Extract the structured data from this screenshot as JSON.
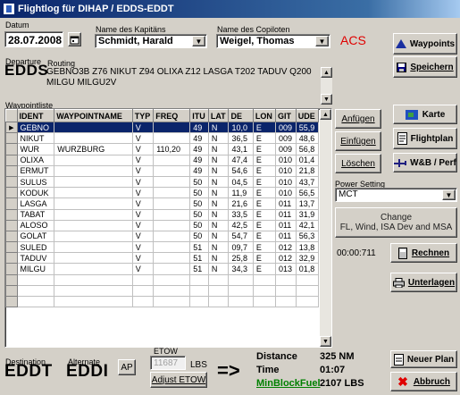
{
  "window": {
    "title": "Flightlog für DIHAP / EDDS-EDDT"
  },
  "datum": {
    "label": "Datum",
    "value": "28.07.2008"
  },
  "kapitaen": {
    "label": "Name des Kapitäns",
    "value": "Schmidt, Harald"
  },
  "copilot": {
    "label": "Name des Copiloten",
    "value": "Weigel, Thomas"
  },
  "acs_label": "ACS",
  "departure": {
    "label": "Departure",
    "code": "EDDS"
  },
  "routing": {
    "label": "Routing",
    "text": "GEBNO3B Z76 NIKUT Z94 OLIXA Z12 LASGA T202 TADUV Q200 MILGU MILGU2V"
  },
  "wpliste_label": "Waypointliste",
  "table": {
    "columns": [
      "IDENT",
      "WAYPOINTNAME",
      "TYP",
      "FREQ",
      "ITU",
      "LAT",
      "DE",
      "LON",
      "GIT",
      "UDE"
    ],
    "rows": [
      [
        "GEBNO",
        "",
        "V",
        "",
        "49",
        "N",
        "10,0",
        "E",
        "009",
        "55,9"
      ],
      [
        "NIKUT",
        "",
        "V",
        "",
        "49",
        "N",
        "36,5",
        "E",
        "009",
        "48,6"
      ],
      [
        "WUR",
        "WURZBURG",
        "V",
        "110,20",
        "49",
        "N",
        "43,1",
        "E",
        "009",
        "56,8"
      ],
      [
        "OLIXA",
        "",
        "V",
        "",
        "49",
        "N",
        "47,4",
        "E",
        "010",
        "01,4"
      ],
      [
        "ERMUT",
        "",
        "V",
        "",
        "49",
        "N",
        "54,6",
        "E",
        "010",
        "21,8"
      ],
      [
        "SULUS",
        "",
        "V",
        "",
        "50",
        "N",
        "04,5",
        "E",
        "010",
        "43,7"
      ],
      [
        "KODUK",
        "",
        "V",
        "",
        "50",
        "N",
        "11,9",
        "E",
        "010",
        "56,5"
      ],
      [
        "LASGA",
        "",
        "V",
        "",
        "50",
        "N",
        "21,6",
        "E",
        "011",
        "13,7"
      ],
      [
        "TABAT",
        "",
        "V",
        "",
        "50",
        "N",
        "33,5",
        "E",
        "011",
        "31,9"
      ],
      [
        "ALOSO",
        "",
        "V",
        "",
        "50",
        "N",
        "42,5",
        "E",
        "011",
        "42,1"
      ],
      [
        "GOLAT",
        "",
        "V",
        "",
        "50",
        "N",
        "54,7",
        "E",
        "011",
        "56,3"
      ],
      [
        "SULED",
        "",
        "V",
        "",
        "51",
        "N",
        "09,7",
        "E",
        "012",
        "13,8"
      ],
      [
        "TADUV",
        "",
        "V",
        "",
        "51",
        "N",
        "25,8",
        "E",
        "012",
        "32,9"
      ],
      [
        "MILGU",
        "",
        "V",
        "",
        "51",
        "N",
        "34,3",
        "E",
        "013",
        "01,8"
      ]
    ]
  },
  "buttons": {
    "waypoints": "Waypoints",
    "speichern": "Speichern",
    "anfuegen": "Anfügen",
    "einfuegen": "Einfügen",
    "loeschen": "Löschen",
    "karte": "Karte",
    "flightplan": "Flightplan",
    "wb_perf": "W&B / Perf",
    "change_line1": "Change",
    "change_line2": "FL, Wind, ISA Dev and MSA",
    "rechnen": "Rechnen",
    "unterlagen": "Unterlagen",
    "neuer_plan": "Neuer Plan",
    "abbruch": "Abbruch",
    "ap": "AP",
    "adjust_etow": "Adjust ETOW"
  },
  "power_setting": {
    "label": "Power Setting",
    "value": "MCT"
  },
  "calc_time": "00:00:711",
  "destination": {
    "label": "Destination",
    "code": "EDDT"
  },
  "alternate": {
    "label": "Alternate",
    "code": "EDDI"
  },
  "etow": {
    "label": "ETOW",
    "value": "11687",
    "unit": "LBS"
  },
  "arrow": "=>",
  "summary": {
    "distance_label": "Distance",
    "distance_value": "325 NM",
    "time_label": "Time",
    "time_value": "01:07",
    "fuel_label": "MinBlockFuel",
    "fuel_value": "2107 LBS"
  },
  "colors": {
    "accent_red": "#e00000",
    "fuel_green": "#008000",
    "selection": "#0a246a"
  }
}
